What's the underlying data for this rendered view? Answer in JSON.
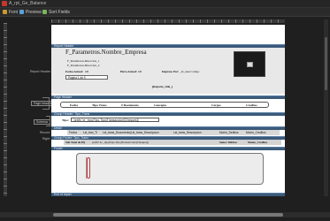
{
  "window": {
    "title": "A_rpt_Ge_Balance"
  },
  "toolbar": {
    "font_label": "Font",
    "preview_label": "Preview",
    "sort_fields_label": "Sort Fields"
  },
  "sections": {
    "report_header": "Report Header",
    "page_header": "Page Header",
    "group_header": "Group Header: Tipo_Trans",
    "detail": "Detail",
    "group_footer": "Group Footer: Tipo_Trans",
    "footer": "Footer",
    "end_of_report": "End of report"
  },
  "side_labels": {
    "report_header": "Report Header",
    "page_header": "Page header",
    "schema": "Schema",
    "record": "Record",
    "right": "Right"
  },
  "report_header": {
    "company": "F_Parametros.Nombre_Empresa",
    "line1": "F_Parametros.Direccion_1",
    "line2": "F_Parametros.Direccion_2",
    "fecha_label": "Fecha Actual:",
    "fecha_value": "#D",
    "hora_label": "Hora Actual:",
    "hora_value": "#D",
    "impreso_label": "Impreso Por:",
    "impreso_value": "_id_user.Codigo",
    "page_field": "Pagina 1 de 9",
    "title_field": "[Reporte_title_]"
  },
  "page_header": {
    "columns": [
      "Fecha",
      "Tipo Trans.",
      "# Documento",
      "Concepto",
      "Cargos",
      "Creditos"
    ]
  },
  "group_header": {
    "tipo_label": "Tipo:",
    "tipo_field": "'prefix' Ie _tipo(Tipo.Tipo)Transaccion/[Cheques]]"
  },
  "detail": {
    "fields": [
      "Fecha",
      "Lst_tran_Ti",
      "Lst_trans_Documento|Lst_trans_Descripcion",
      "Lst_trans_Descripcion",
      "Monto_Debitos",
      "Monto_Creditos"
    ]
  },
  "group_footer": {
    "label": "Sub Total de ##]",
    "expr": "prefix' Ie _tipo(Tipo.Tipo)Transaccion/[Cheques]]",
    "total_debitos": "Suma: Debitos",
    "total_creditos": "Monto_Creditos"
  }
}
